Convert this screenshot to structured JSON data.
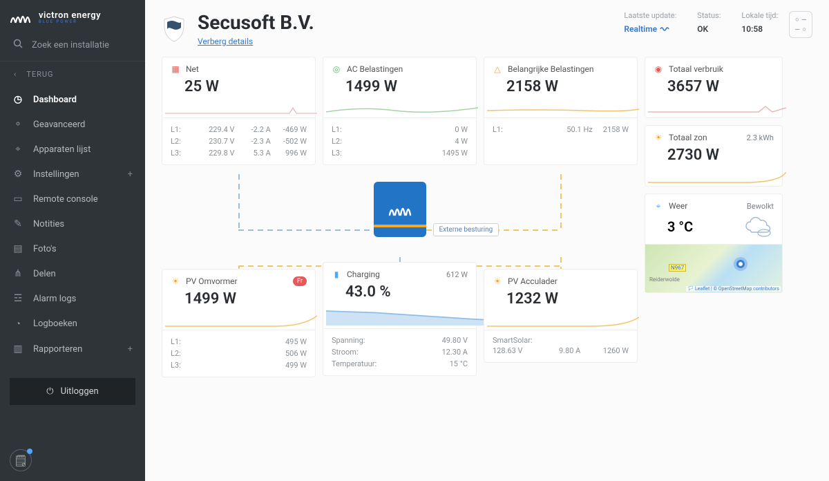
{
  "brand": {
    "name": "victron energy",
    "tagline": "BLUE POWER"
  },
  "search": {
    "placeholder": "Zoek een installatie"
  },
  "back": "TERUG",
  "nav": [
    {
      "key": "dashboard",
      "label": "Dashboard",
      "icon": "gauge"
    },
    {
      "key": "advanced",
      "label": "Geavanceerd",
      "icon": "nodes"
    },
    {
      "key": "devices",
      "label": "Apparaten lijst",
      "icon": "pin"
    },
    {
      "key": "settings",
      "label": "Instellingen",
      "icon": "gear",
      "plus": true
    },
    {
      "key": "remote",
      "label": "Remote console",
      "icon": "console"
    },
    {
      "key": "notes",
      "label": "Notities",
      "icon": "note"
    },
    {
      "key": "photos",
      "label": "Foto's",
      "icon": "photo"
    },
    {
      "key": "share",
      "label": "Delen",
      "icon": "share"
    },
    {
      "key": "alarms",
      "label": "Alarm logs",
      "icon": "alarm"
    },
    {
      "key": "logs",
      "label": "Logboeken",
      "icon": "clock"
    },
    {
      "key": "report",
      "label": "Rapporteren",
      "icon": "report",
      "plus": true
    }
  ],
  "logout": "Uitloggen",
  "header": {
    "title": "Secusoft B.V.",
    "details_link": "Verberg details",
    "meta": {
      "update_lbl": "Laatste update:",
      "update_val": "Realtime",
      "status_lbl": "Status:",
      "status_val": "OK",
      "time_lbl": "Lokale tijd:",
      "time_val": "10:58"
    }
  },
  "cards": {
    "net": {
      "title": "Net",
      "value": "25 W",
      "rows": [
        {
          "ph": "L1:",
          "v": "229.4 V",
          "a": "-2.2 A",
          "w": "-469 W"
        },
        {
          "ph": "L2:",
          "v": "230.7 V",
          "a": "-2.3 A",
          "w": "-502 W"
        },
        {
          "ph": "L3:",
          "v": "229.8 V",
          "a": "5.3 A",
          "w": "996 W"
        }
      ]
    },
    "ac": {
      "title": "AC Belastingen",
      "value": "1499 W",
      "rows": [
        {
          "ph": "L1:",
          "w": "0 W"
        },
        {
          "ph": "L2:",
          "w": "4 W"
        },
        {
          "ph": "L3:",
          "w": "1495 W"
        }
      ]
    },
    "crit": {
      "title": "Belangrijke Belastingen",
      "value": "2158 W",
      "rows": [
        {
          "ph": "L1:",
          "hz": "50.1 Hz",
          "w": "2158 W"
        }
      ]
    },
    "consumption": {
      "title": "Totaal verbruik",
      "value": "3657 W"
    },
    "solar": {
      "title": "Totaal zon",
      "kwh": "2.3 kWh",
      "value": "2730 W"
    },
    "node_tag": "Externe besturing",
    "pv_inv": {
      "title": "PV Omvormer",
      "badge": "Fr",
      "value": "1499 W",
      "rows": [
        {
          "ph": "L1:",
          "w": "495 W"
        },
        {
          "ph": "L2:",
          "w": "506 W"
        },
        {
          "ph": "L3:",
          "w": "499 W"
        }
      ]
    },
    "battery": {
      "title": "Charging",
      "watts": "612 W",
      "value": "43.0 %",
      "lines": [
        {
          "l": "Spanning:",
          "r": "49.80 V"
        },
        {
          "l": "Stroom:",
          "r": "12.30 A"
        },
        {
          "l": "Temperatuur:",
          "r": "15 °C"
        }
      ]
    },
    "pv_chg": {
      "title": "PV Acculader",
      "value": "1232 W",
      "sub_label": "SmartSolar:",
      "sub": {
        "v": "128.63 V",
        "a": "9.80 A",
        "w": "1260 W"
      }
    },
    "weather": {
      "title": "Weer",
      "state": "Bewolkt",
      "temp": "3 °C",
      "road": "N967",
      "place": "Reiderwolde",
      "attr_leaflet": "Leaflet",
      "attr_osm": "© OpenStreetMap contributors"
    }
  }
}
